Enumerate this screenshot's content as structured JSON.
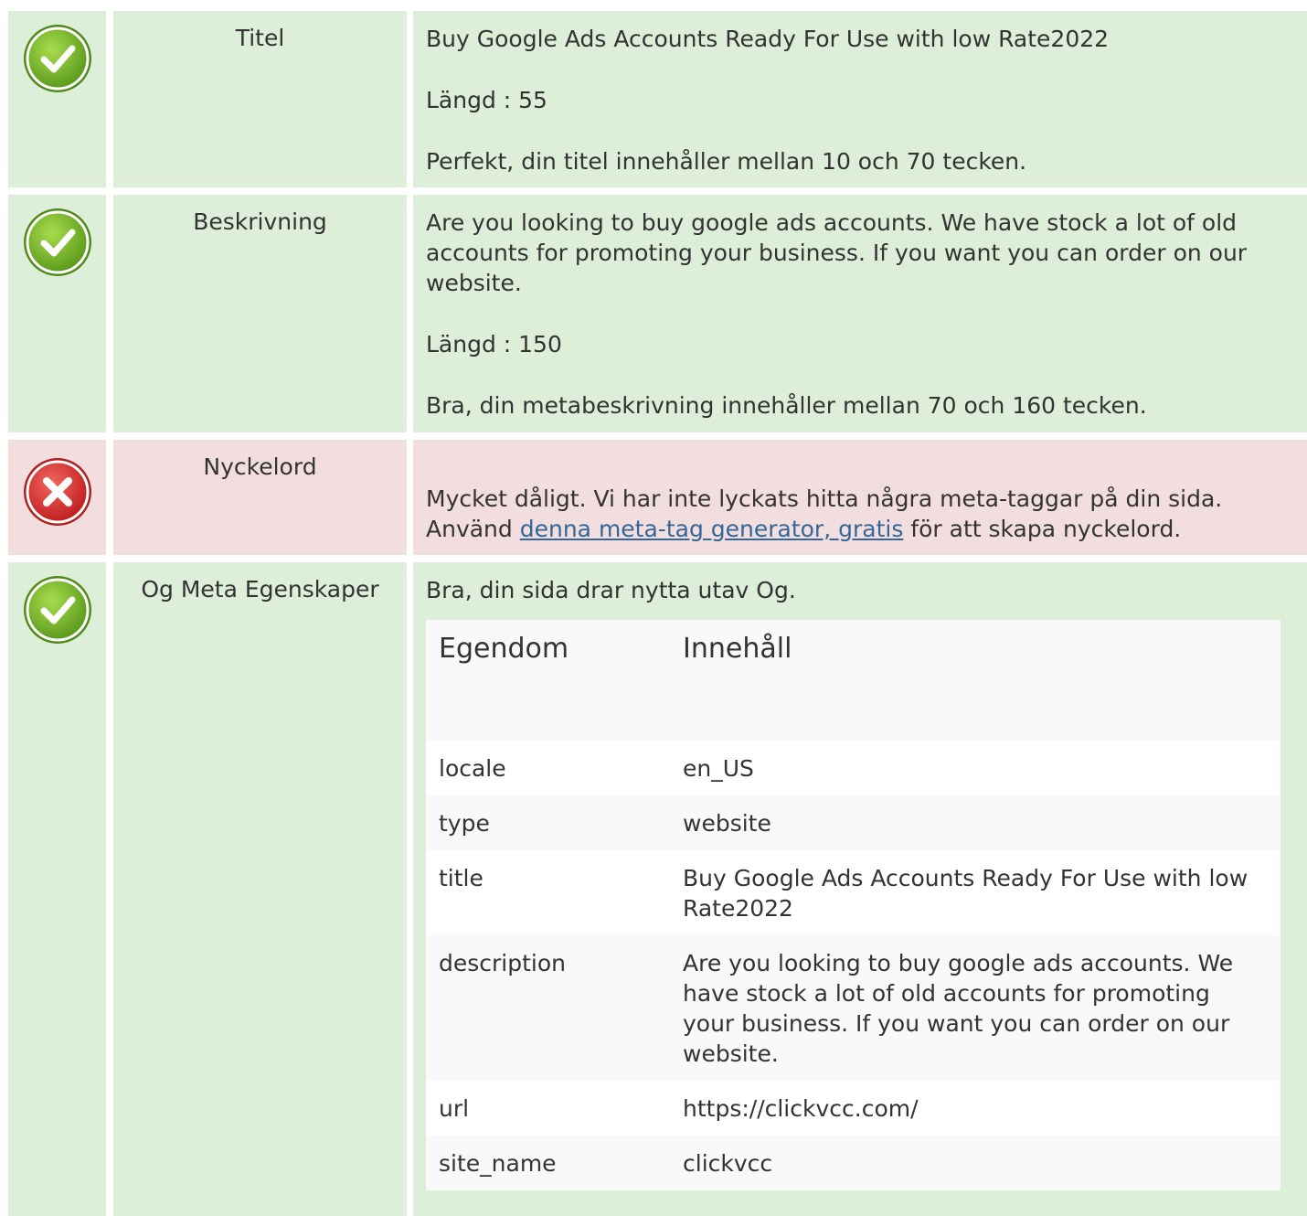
{
  "rows": {
    "titel": {
      "label": "Titel",
      "status": "pass",
      "title_value": "Buy Google Ads Accounts Ready For Use with low Rate2022",
      "length": "Längd : 55",
      "message": "Perfekt, din titel innehåller mellan 10 och 70 tecken."
    },
    "beskrivning": {
      "label": "Beskrivning",
      "status": "pass",
      "description_value": "Are you looking to buy google ads accounts. We have stock a lot of old accounts for promoting your business. If you want you can order on our website.",
      "length": "Längd : 150",
      "message": "Bra, din metabeskrivning innehåller mellan 70 och 160 tecken."
    },
    "nyckelord": {
      "label": "Nyckelord",
      "status": "fail",
      "message_line1": "Mycket dåligt. Vi har inte lyckats hitta några meta-taggar på din sida.",
      "message_prefix": "Använd",
      "link_text": "denna meta-tag generator, gratis",
      "message_suffix": "för att skapa nyckelord."
    },
    "og": {
      "label": "Og Meta Egenskaper",
      "status": "pass",
      "message": "Bra, din sida drar nytta utav Og.",
      "table": {
        "headers": [
          "Egendom",
          "Innehåll"
        ],
        "rows": [
          [
            "locale",
            "en_US"
          ],
          [
            "type",
            "website"
          ],
          [
            "title",
            "Buy Google Ads Accounts Ready For Use with low Rate2022"
          ],
          [
            "description",
            "Are you looking to buy google ads accounts. We have stock a lot of old accounts for promoting your business. If you want you can order on our website."
          ],
          [
            "url",
            "https://clickvcc.com/"
          ],
          [
            "site_name",
            "clickvcc"
          ]
        ]
      }
    }
  },
  "colors": {
    "pass_bg": "#deefd9",
    "fail_bg": "#f2dede",
    "pass_icon": "#7cb82f",
    "fail_icon": "#d9383a",
    "link": "#336699"
  },
  "icons": {
    "pass": "check-circle-icon",
    "fail": "cross-circle-icon"
  }
}
